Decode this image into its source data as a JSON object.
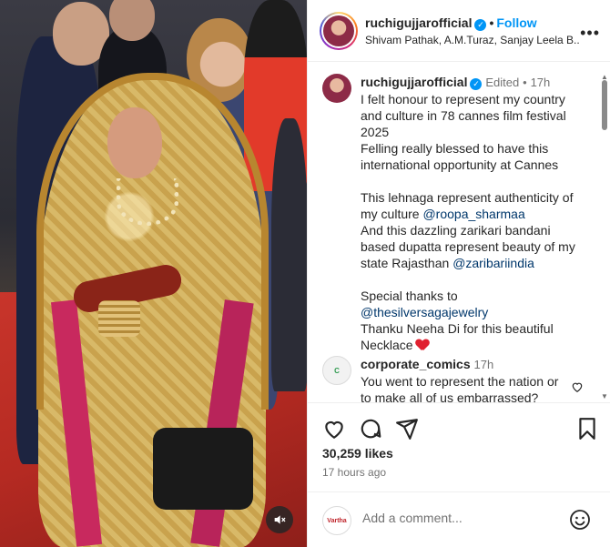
{
  "post": {
    "username": "ruchigujjarofficial",
    "follow_label": "Follow",
    "dot": "•",
    "tagged": "Shivam Pathak, A.M.Turaz, Sanjay Leela B...",
    "more": "•••"
  },
  "caption": {
    "username": "ruchigujjarofficial",
    "edited": "Edited",
    "dot": "•",
    "time": "17h",
    "line1": "I felt honour to represent my country and culture in 78 cannes film festival 2025",
    "line2": "Felling really blessed to have this international opportunity at Cannes",
    "line3_prefix": "This lehnaga represent authenticity of my culture",
    "mention1": "@roopa_sharmaa",
    "line4_prefix": "And this dazzling zarikari bandani based dupatta represent beauty of my state Rajasthan",
    "mention2": "@zaribariindia",
    "line5_prefix": "Special thanks to",
    "mention3": "@thesilversagajewelry",
    "line6": "Thanku Neeha Di for this beautiful Necklace"
  },
  "comment2": {
    "username": "corporate_comics",
    "time": "17h",
    "text": "You went to represent the nation or to make all of us embarrassed?",
    "avatar_text": "C"
  },
  "stats": {
    "likes": "30,259 likes",
    "posted": "17 hours ago"
  },
  "add_comment": {
    "placeholder": "Add a comment...",
    "avatar_text": "Vartha"
  },
  "icons": {
    "like": "heart-icon",
    "comment": "comment-icon",
    "share": "send-icon",
    "save": "bookmark-icon",
    "mute": "muted-speaker-icon",
    "emoji": "emoji-icon",
    "verified": "verified-badge-icon"
  },
  "colors": {
    "accent": "#0095f6",
    "mention": "#00376b",
    "heart": "#e0202f"
  }
}
